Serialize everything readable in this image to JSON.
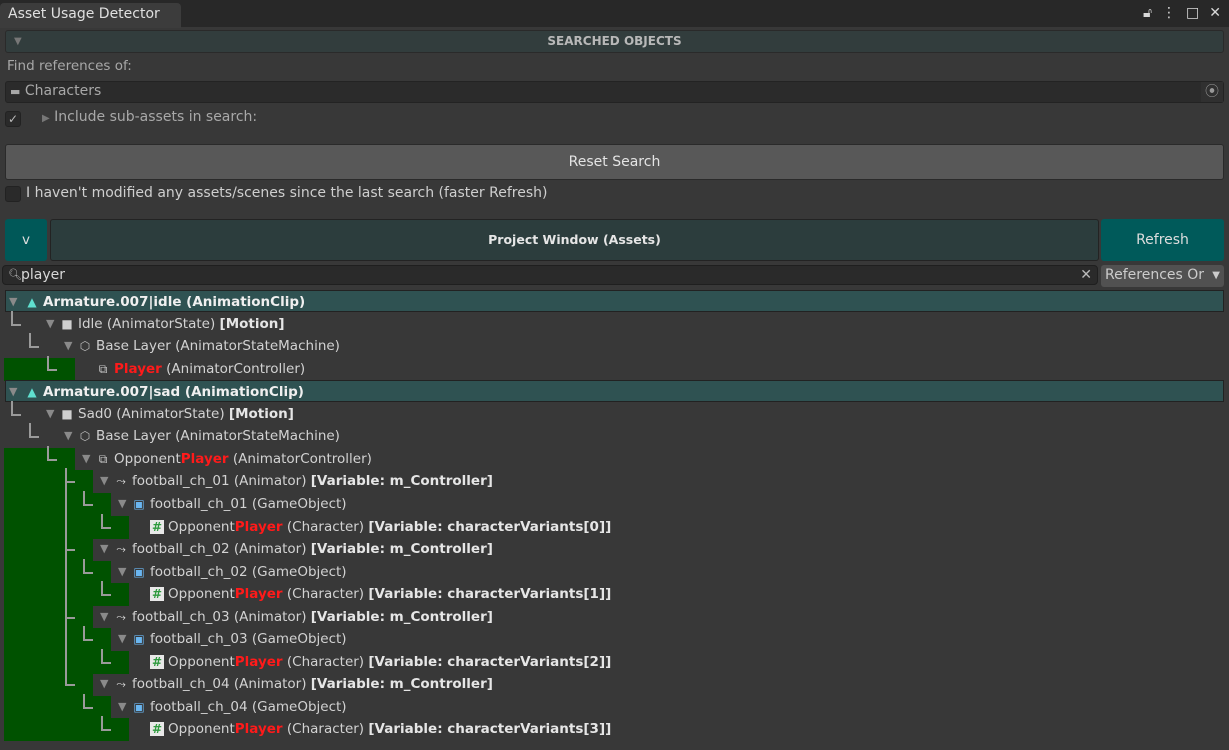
{
  "window": {
    "tab_title": "Asset Usage Detector",
    "buttons": [
      "lock-icon",
      "menu-icon",
      "maximize-icon",
      "close-icon"
    ]
  },
  "searched_objects": {
    "header": "SEARCHED OBJECTS",
    "find_label": "Find references of:",
    "object_field": "Characters",
    "include_subassets_label": "Include sub-assets in search:",
    "include_subassets_checked": true
  },
  "reset_button": "Reset Search",
  "faster_refresh": {
    "label": "I haven't modified any assets/scenes since the last search (faster Refresh)",
    "checked": false
  },
  "results_bar": {
    "collapse_label": "v",
    "section_label": "Project Window (Assets)",
    "refresh_label": "Refresh"
  },
  "filter": {
    "search_value": "player",
    "mode_dropdown": "References Or"
  },
  "colors": {
    "root_row": "#2f5252",
    "highlight": "#005200",
    "match": "#ff1a1a",
    "refresh": "#005a5a"
  },
  "tree": [
    {
      "depth": 0,
      "arrow": true,
      "icon": "animation-clip-icon",
      "parts": [
        {
          "t": "Armature.007|idle (AnimationClip)"
        }
      ]
    },
    {
      "depth": 1,
      "arrow": true,
      "icon": "animator-state-icon",
      "parts": [
        {
          "t": "Idle (AnimatorState) "
        },
        {
          "t": "[Motion]",
          "s": "b"
        }
      ]
    },
    {
      "depth": 2,
      "arrow": true,
      "icon": "state-machine-icon",
      "parts": [
        {
          "t": "Base Layer (AnimatorStateMachine)"
        }
      ]
    },
    {
      "depth": 3,
      "arrow": false,
      "icon": "animator-controller-icon",
      "hl": true,
      "parts": [
        {
          "t": "Player",
          "s": "red"
        },
        {
          "t": " (AnimatorController)"
        }
      ]
    },
    {
      "depth": 0,
      "arrow": true,
      "icon": "animation-clip-icon",
      "parts": [
        {
          "t": "Armature.007|sad (AnimationClip)"
        }
      ]
    },
    {
      "depth": 1,
      "arrow": true,
      "icon": "animator-state-icon",
      "parts": [
        {
          "t": "Sad0 (AnimatorState) "
        },
        {
          "t": "[Motion]",
          "s": "b"
        }
      ]
    },
    {
      "depth": 2,
      "arrow": true,
      "icon": "state-machine-icon",
      "parts": [
        {
          "t": "Base Layer (AnimatorStateMachine)"
        }
      ]
    },
    {
      "depth": 3,
      "arrow": true,
      "icon": "animator-controller-icon",
      "hl": true,
      "parts": [
        {
          "t": "Opponent"
        },
        {
          "t": "Player",
          "s": "red"
        },
        {
          "t": " (AnimatorController)"
        }
      ]
    },
    {
      "depth": 4,
      "arrow": true,
      "icon": "animator-icon",
      "hl": true,
      "parts": [
        {
          "t": "football_ch_01 (Animator) "
        },
        {
          "t": "[Variable: m_Controller]",
          "s": "b"
        }
      ]
    },
    {
      "depth": 5,
      "arrow": true,
      "icon": "gameobject-icon",
      "hl": true,
      "parts": [
        {
          "t": "football_ch_01 (GameObject)"
        }
      ]
    },
    {
      "depth": 6,
      "arrow": false,
      "icon": "script-icon",
      "hl": true,
      "parts": [
        {
          "t": "Opponent"
        },
        {
          "t": "Player",
          "s": "red"
        },
        {
          "t": " (Character) "
        },
        {
          "t": "[Variable: characterVariants[0]]",
          "s": "b"
        }
      ]
    },
    {
      "depth": 4,
      "arrow": true,
      "icon": "animator-icon",
      "hl": true,
      "parts": [
        {
          "t": "football_ch_02 (Animator) "
        },
        {
          "t": "[Variable: m_Controller]",
          "s": "b"
        }
      ]
    },
    {
      "depth": 5,
      "arrow": true,
      "icon": "gameobject-icon",
      "hl": true,
      "parts": [
        {
          "t": "football_ch_02 (GameObject)"
        }
      ]
    },
    {
      "depth": 6,
      "arrow": false,
      "icon": "script-icon",
      "hl": true,
      "parts": [
        {
          "t": "Opponent"
        },
        {
          "t": "Player",
          "s": "red"
        },
        {
          "t": " (Character) "
        },
        {
          "t": "[Variable: characterVariants[1]]",
          "s": "b"
        }
      ]
    },
    {
      "depth": 4,
      "arrow": true,
      "icon": "animator-icon",
      "hl": true,
      "parts": [
        {
          "t": "football_ch_03 (Animator) "
        },
        {
          "t": "[Variable: m_Controller]",
          "s": "b"
        }
      ]
    },
    {
      "depth": 5,
      "arrow": true,
      "icon": "gameobject-icon",
      "hl": true,
      "parts": [
        {
          "t": "football_ch_03 (GameObject)"
        }
      ]
    },
    {
      "depth": 6,
      "arrow": false,
      "icon": "script-icon",
      "hl": true,
      "parts": [
        {
          "t": "Opponent"
        },
        {
          "t": "Player",
          "s": "red"
        },
        {
          "t": " (Character) "
        },
        {
          "t": "[Variable: characterVariants[2]]",
          "s": "b"
        }
      ]
    },
    {
      "depth": 4,
      "arrow": true,
      "icon": "animator-icon",
      "hl": true,
      "parts": [
        {
          "t": "football_ch_04 (Animator) "
        },
        {
          "t": "[Variable: m_Controller]",
          "s": "b"
        }
      ]
    },
    {
      "depth": 5,
      "arrow": true,
      "icon": "gameobject-icon",
      "hl": true,
      "parts": [
        {
          "t": "football_ch_04 (GameObject)"
        }
      ]
    },
    {
      "depth": 6,
      "arrow": false,
      "icon": "script-icon",
      "hl": true,
      "parts": [
        {
          "t": "Opponent"
        },
        {
          "t": "Player",
          "s": "red"
        },
        {
          "t": " (Character) "
        },
        {
          "t": "[Variable: characterVariants[3]]",
          "s": "b"
        }
      ]
    }
  ]
}
